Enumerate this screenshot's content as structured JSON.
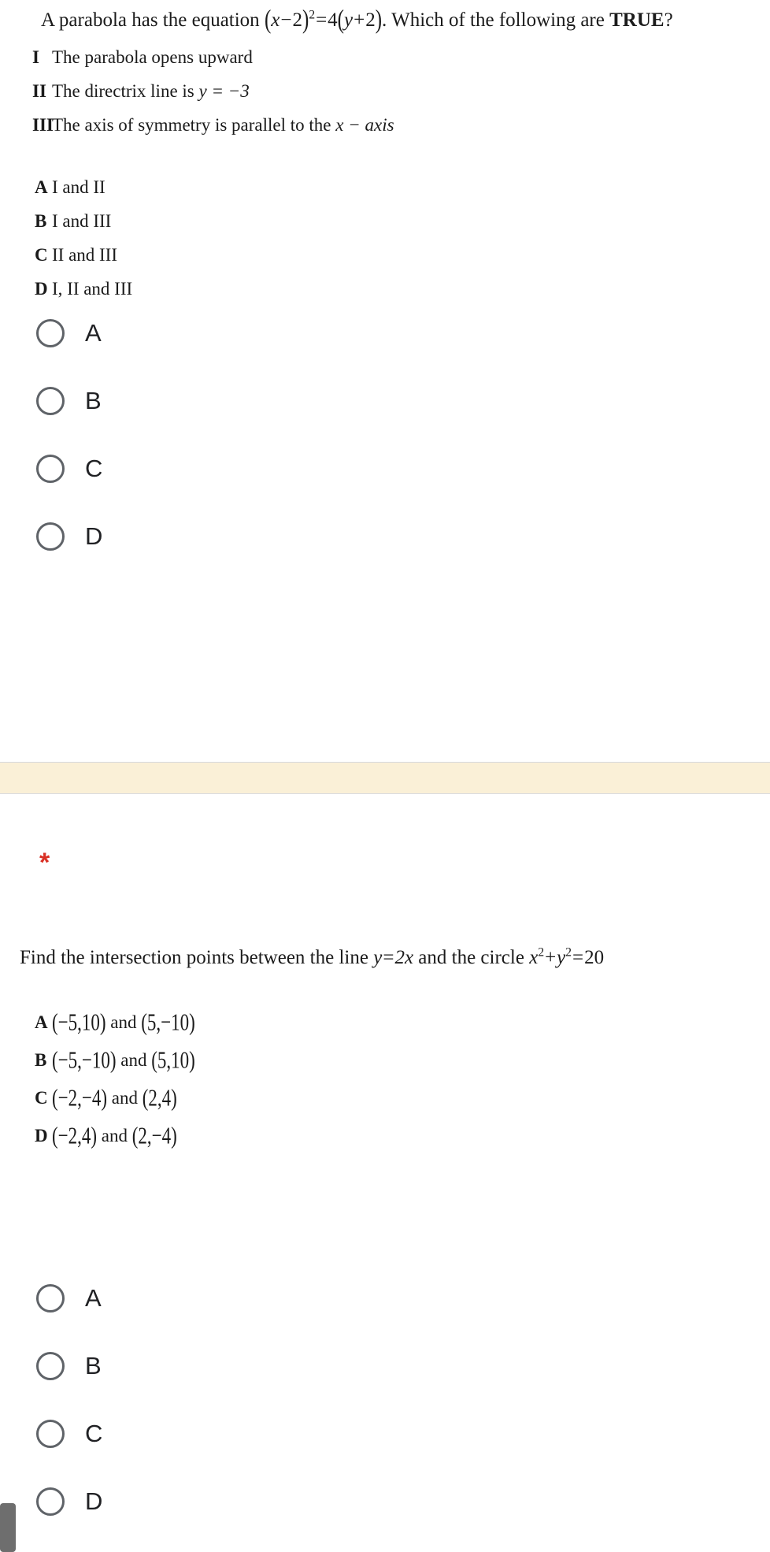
{
  "page": {
    "background_color": "#ffffff",
    "required_marker": "*",
    "required_marker_color": "#d93025",
    "divider_color": "#faf0d7",
    "radio_outline_color": "#5f6368",
    "scrollbar_color": "#6e6e6e"
  },
  "question1": {
    "stem_plain": "A parabola has the equation (x−2)² = 4(y+2). Which of the following are TRUE?",
    "stem": {
      "lead": "A parabola has the equation ",
      "eq_open": "(",
      "eq_x": "x",
      "eq_minus": "−",
      "eq_2": "2",
      "eq_close": ")",
      "eq_exp": "2",
      "eq_equals": "=",
      "eq_four": "4",
      "eq_open2": "(",
      "eq_y": "y",
      "eq_plus": "+",
      "eq_2b": "2",
      "eq_close2": ")",
      "tail_before_bold": ". Which of the following are ",
      "tail_bold": "TRUE",
      "tail_after_bold": "?"
    },
    "statements": [
      {
        "label": "I",
        "text": "The parabola opens upward",
        "math": ""
      },
      {
        "label": "II",
        "text": "The directrix line is ",
        "math": "y = −3"
      },
      {
        "label": "III",
        "text": "The axis of symmetry is parallel to the ",
        "math": "x − axis"
      }
    ],
    "choices": [
      {
        "label": "A",
        "text": "I and II"
      },
      {
        "label": "B",
        "text": "I and III"
      },
      {
        "label": "C",
        "text": "II and III"
      },
      {
        "label": "D",
        "text": "I, II and III"
      }
    ],
    "radio_options": [
      {
        "value": "A",
        "selected": false
      },
      {
        "value": "B",
        "selected": false
      },
      {
        "value": "C",
        "selected": false
      },
      {
        "value": "D",
        "selected": false
      }
    ]
  },
  "question2": {
    "stem_plain": "Find the intersection points between the line y = 2x and the circle x² + y² = 20",
    "stem": {
      "lead": "Find the intersection points between the line ",
      "line_y": "y",
      "line_eq": "=",
      "line_2x": "2x",
      "mid": " and the circle ",
      "c_x": "x",
      "c_x_exp": "2",
      "c_plus": "+",
      "c_y": "y",
      "c_y_exp": "2",
      "c_eq": "=",
      "c_val": "20"
    },
    "choices": [
      {
        "label": "A",
        "text": "(−5,10) and (5,−10)",
        "p1": "(−5,10)",
        "conj": " and ",
        "p2": "(5,−10)"
      },
      {
        "label": "B",
        "text": "(−5,−10) and (5,10)",
        "p1": "(−5,−10)",
        "conj": " and ",
        "p2": "(5,10)"
      },
      {
        "label": "C",
        "text": "(−2,−4) and (2,4)",
        "p1": "(−2,−4)",
        "conj": " and ",
        "p2": "(2,4)"
      },
      {
        "label": "D",
        "text": "(−2,4) and (2,−4)",
        "p1": "(−2,4)",
        "conj": " and ",
        "p2": "(2,−4)"
      }
    ],
    "radio_options": [
      {
        "value": "A",
        "selected": false
      },
      {
        "value": "B",
        "selected": false
      },
      {
        "value": "C",
        "selected": false
      },
      {
        "value": "D",
        "selected": false
      }
    ]
  }
}
